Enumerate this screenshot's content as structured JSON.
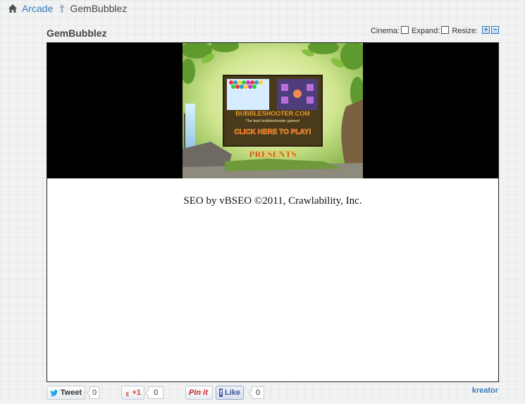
{
  "breadcrumb": {
    "icon": "home-icon",
    "arcade_label": "Arcade",
    "separator_icon": "breadcrumb-arrow-icon",
    "current_label": "GemBubblez"
  },
  "game": {
    "title": "GemBubblez"
  },
  "controls": {
    "cinema_label": "Cinema:",
    "expand_label": "Expand:",
    "resize_label": "Resize:",
    "cinema_checked": false,
    "expand_checked": false,
    "enlarge_symbol": "+",
    "shrink_symbol": "−"
  },
  "banner": {
    "site_name": "BUBBLESHOOTER.COM",
    "tagline": "The best bubbleshooter games!",
    "cta": "CLICK HERE TO PLAY!",
    "presents": "PRESENTS"
  },
  "seo_footer": "SEO by vBSEO ©2011, Crawlability, Inc.",
  "share": {
    "tweet_label": "Tweet",
    "tweet_count": "0",
    "gplus_label": "+1",
    "gplus_count": "0",
    "pinit_label": "Pin it",
    "like_label": "Like",
    "like_count": "0"
  },
  "author": "kreator",
  "colors": {
    "link": "#3a7bbd",
    "panel_bg": "#ffffff",
    "video_bg": "#000000"
  }
}
